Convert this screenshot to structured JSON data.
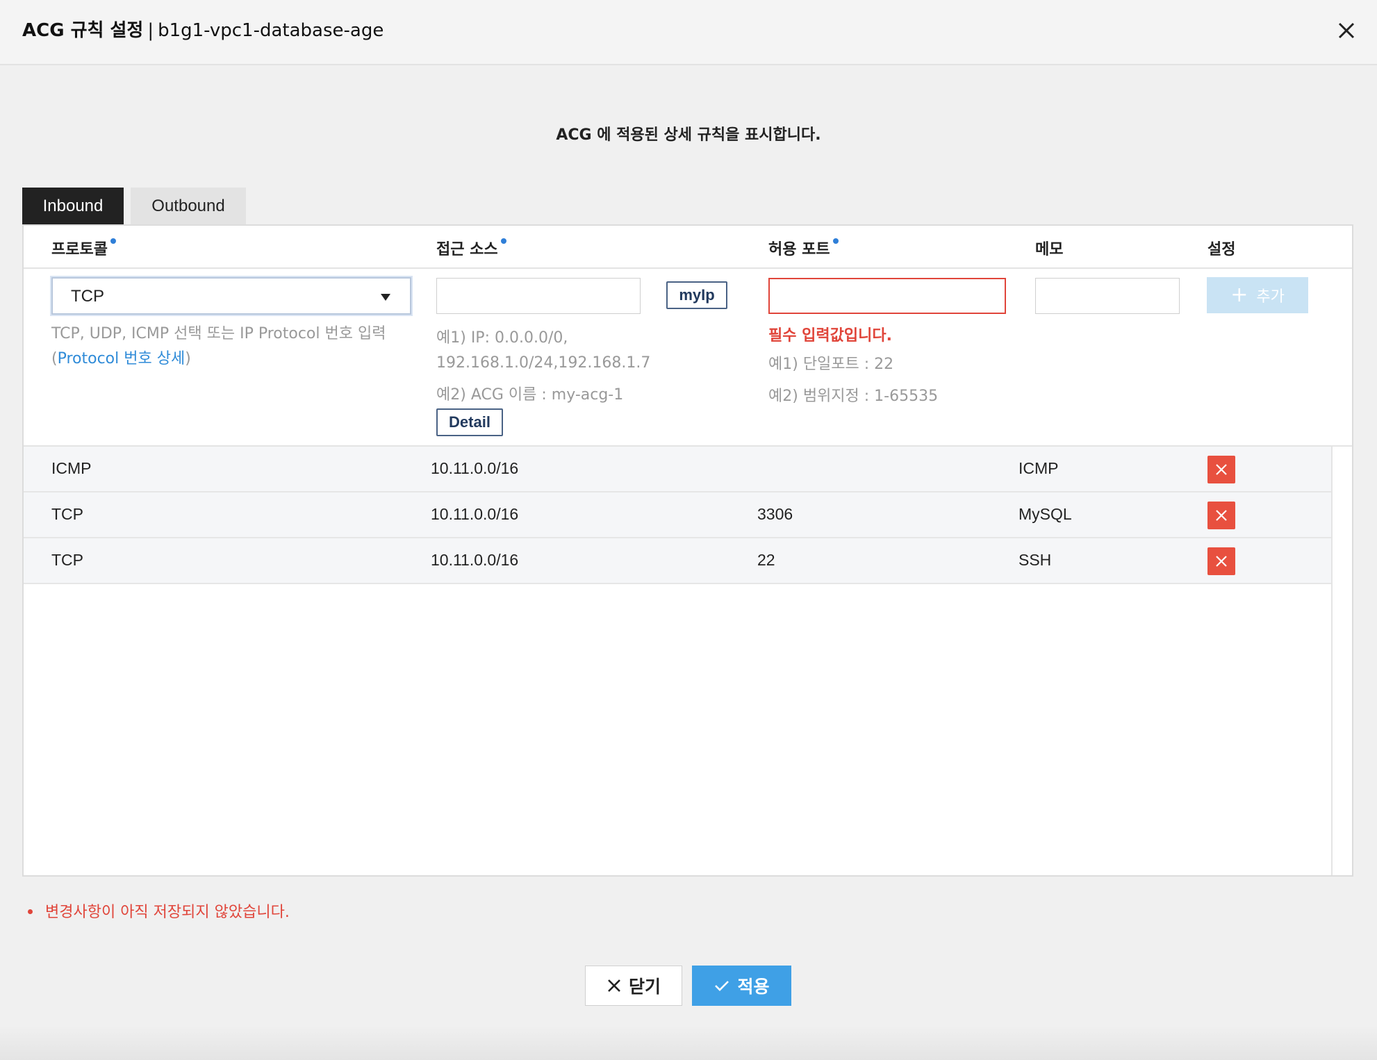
{
  "header": {
    "title": "ACG 규칙 설정",
    "separator": "|",
    "acg_name": "b1g1-vpc1-database-age",
    "close_icon": "close-icon"
  },
  "intro_text": "ACG 에 적용된 상세 규칙을 표시합니다.",
  "tabs": [
    {
      "label": "Inbound",
      "active": true
    },
    {
      "label": "Outbound",
      "active": false
    }
  ],
  "columns": {
    "protocol": "프로토콜",
    "source": "접근 소스",
    "port": "허용 포트",
    "memo": "메모",
    "settings": "설정"
  },
  "form": {
    "protocol_value": "TCP",
    "protocol_hint": "TCP, UDP, ICMP 선택 또는 IP Protocol 번호 입력",
    "protocol_link_open": "(",
    "protocol_link": "Protocol 번호 상세",
    "protocol_link_close": ")",
    "source_value": "",
    "myip_label": "myIp",
    "source_example1_line1": "예1) IP: 0.0.0.0/0,",
    "source_example1_line2": "192.168.1.0/24,192.168.1.7",
    "source_example2": "예2) ACG 이름 : my-acg-1",
    "detail_label": "Detail",
    "port_value": "",
    "port_error": "필수 입력값입니다.",
    "port_example1": "예1) 단일포트 : 22",
    "port_example2": "예2) 범위지정 : 1-65535",
    "memo_value": "",
    "add_label": "추가"
  },
  "rules": [
    {
      "protocol": "ICMP",
      "source": "10.11.0.0/16",
      "port": "",
      "memo": "ICMP"
    },
    {
      "protocol": "TCP",
      "source": "10.11.0.0/16",
      "port": "3306",
      "memo": "MySQL"
    },
    {
      "protocol": "TCP",
      "source": "10.11.0.0/16",
      "port": "22",
      "memo": "SSH"
    }
  ],
  "unsaved_notice": "변경사항이 아직 저장되지 않았습니다.",
  "footer": {
    "close_label": "닫기",
    "apply_label": "적용"
  },
  "colors": {
    "accent": "#3fa0e6",
    "error": "#e0453a",
    "required_dot": "#2f7fd8",
    "delete": "#e8503f"
  }
}
